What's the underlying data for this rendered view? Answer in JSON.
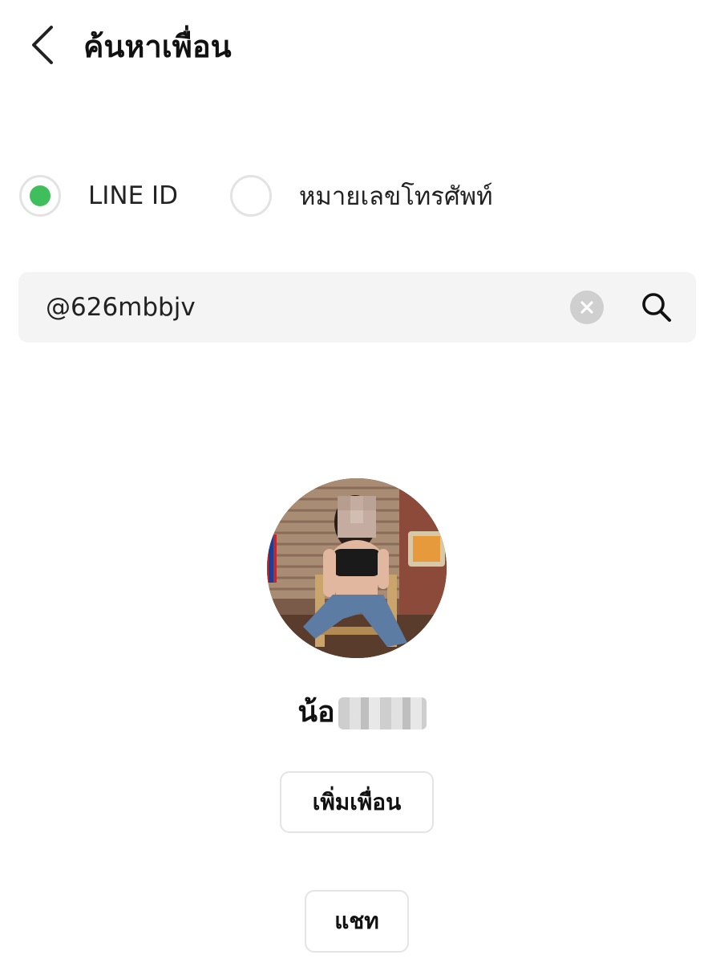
{
  "header": {
    "title": "ค้นหาเพื่อน"
  },
  "search_type": {
    "options": [
      {
        "label": "LINE ID",
        "selected": true
      },
      {
        "label": "หมายเลขโทรศัพท์",
        "selected": false
      }
    ],
    "selected_color": "#3fbf5c"
  },
  "search": {
    "value": "@626mbbjv"
  },
  "profile": {
    "name_visible": "น้อ"
  },
  "actions": {
    "add_friend_label": "เพิ่มเพื่อน",
    "chat_label": "แชท"
  }
}
